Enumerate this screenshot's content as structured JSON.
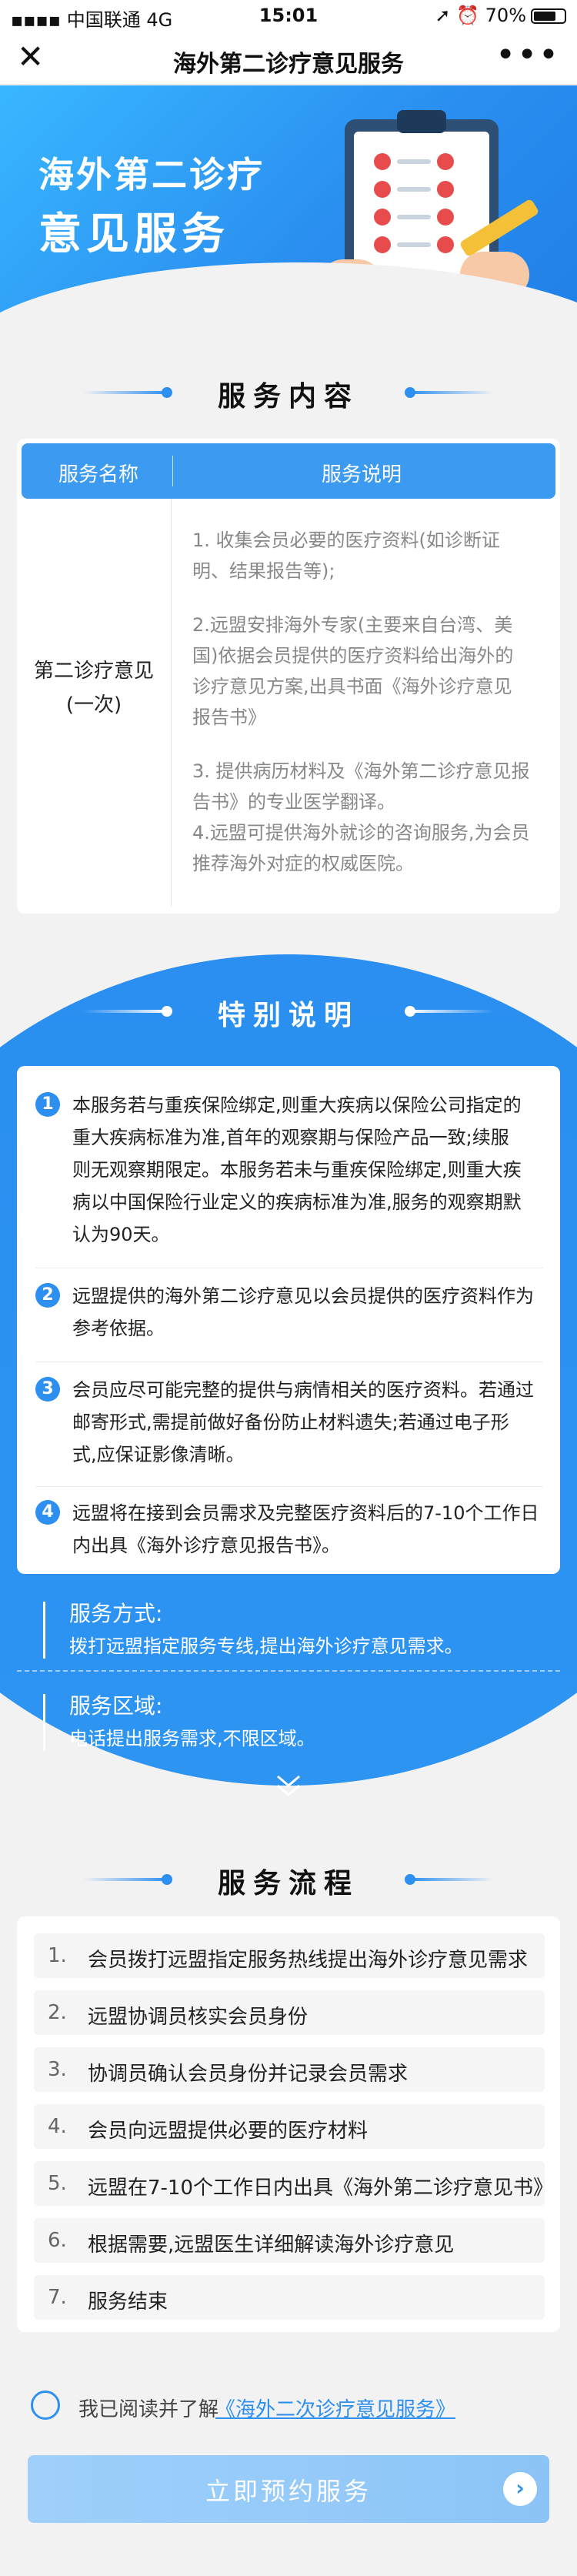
{
  "status_bar": {
    "carrier": "中国联通",
    "network": "4G",
    "time": "15:01",
    "battery": "70%"
  },
  "nav": {
    "title": "海外第二诊疗意见服务",
    "close_glyph": "✕",
    "more_glyph": "•••"
  },
  "banner": {
    "line1": "海外第二诊疗",
    "line2": "意见服务"
  },
  "service_content": {
    "title": "服务内容",
    "col_name": "服务名称",
    "col_desc": "服务说明",
    "name_line1": "第二诊疗意见",
    "name_line2": "(一次)",
    "desc": [
      "1. 收集会员必要的医疗资料(如诊断证",
      "明、结果报告等);",
      "2.远盟安排海外专家(主要来自台湾、美",
      "国)依据会员提供的医疗资料给出海外的",
      "诊疗意见方案,出具书面《海外诊疗意见",
      "报告书》",
      "3. 提供病历材料及《海外第二诊疗意见报",
      "告书》的专业医学翻译。",
      "4.远盟可提供海外就诊的咨询服务,为会员",
      "推荐海外对症的权威医院。"
    ]
  },
  "special": {
    "title": "特别说明",
    "notes": [
      {
        "num": "1",
        "lines": [
          "本服务若与重疾保险绑定,则重大疾病以保险公司指定的",
          "重大疾病标准为准,首年的观察期与保险产品一致;续服",
          "则无观察期限定。本服务若未与重疾保险绑定,则重大疾",
          "病以中国保险行业定义的疾病标准为准,服务的观察期默",
          "认为90天。"
        ]
      },
      {
        "num": "2",
        "lines": [
          "远盟提供的海外第二诊疗意见以会员提供的医疗资料作为",
          "参考依据。"
        ]
      },
      {
        "num": "3",
        "lines": [
          "会员应尽可能完整的提供与病情相关的医疗资料。若通过",
          "邮寄形式,需提前做好备份防止材料遗失;若通过电子形",
          "式,应保证影像清晰。"
        ]
      },
      {
        "num": "4",
        "lines": [
          "远盟将在接到会员需求及完整医疗资料后的7-10个工作日",
          "内出具《海外诊疗意见报告书》。"
        ]
      }
    ],
    "method_label": "服务方式:",
    "method_value": "拨打远盟指定服务专线,提出海外诊疗意见需求。",
    "area_label": "服务区域:",
    "area_value": "电话提出服务需求,不限区域。"
  },
  "process": {
    "title": "服务流程",
    "steps": [
      {
        "n": "1.",
        "s": "会员拨打远盟指定服务热线提出海外诊疗意见需求"
      },
      {
        "n": "2.",
        "s": "远盟协调员核实会员身份"
      },
      {
        "n": "3.",
        "s": "协调员确认会员身份并记录会员需求"
      },
      {
        "n": "4.",
        "s": "会员向远盟提供必要的医疗材料"
      },
      {
        "n": "5.",
        "s": "远盟在7-10个工作日内出具《海外第二诊疗意见书》"
      },
      {
        "n": "6.",
        "s": "根据需要,远盟医生详细解读海外诊疗意见"
      },
      {
        "n": "7.",
        "s": "服务结束"
      }
    ]
  },
  "agree": {
    "prefix": "我已阅读并了解",
    "link": "《海外二次诊疗意见服务》"
  },
  "cta": {
    "label": "立即预约服务",
    "arrow": "›"
  },
  "colors": {
    "primary": "#2d8ff0",
    "banner": "#39b7ff",
    "button": "#9fd0fb"
  }
}
